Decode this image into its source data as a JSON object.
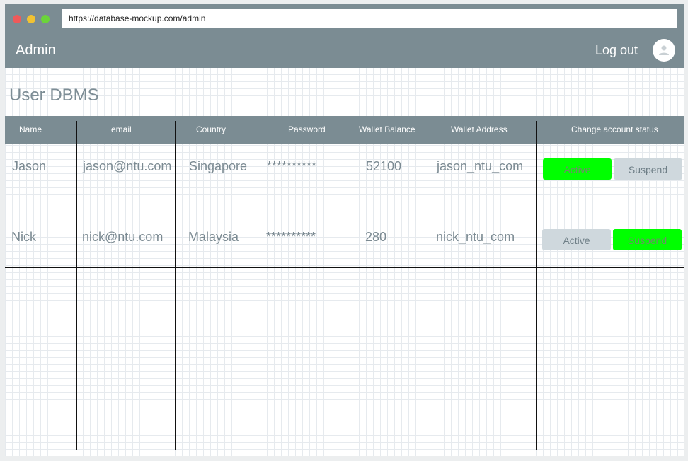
{
  "browser": {
    "url": "https://database-mockup.com/admin"
  },
  "header": {
    "title": "Admin",
    "logout_label": "Log out",
    "avatar_icon": "user-avatar-icon"
  },
  "page": {
    "title": "User DBMS"
  },
  "table": {
    "columns": [
      "Name",
      "email",
      "Country",
      "Password",
      "Wallet Balance",
      "Wallet Address",
      "Change account status"
    ],
    "rows": [
      {
        "name": "Jason",
        "email": "jason@ntu.com",
        "country": "Singapore",
        "password": "**********",
        "wallet_balance": "52100",
        "wallet_address": "jason_ntu_com",
        "active_label": "Active",
        "suspend_label": "Suspend",
        "status": "active"
      },
      {
        "name": "Nick",
        "email": "nick@ntu.com",
        "country": "Malaysia",
        "password": "**********",
        "wallet_balance": "280",
        "wallet_address": "nick_ntu_com",
        "active_label": "Active",
        "suspend_label": "Suspend",
        "status": "suspended"
      }
    ]
  },
  "colors": {
    "header_bg": "#7b8c93",
    "selected_status": "#00ff00",
    "unselected_status": "#cfd8dd",
    "text": "#7b8a92"
  }
}
